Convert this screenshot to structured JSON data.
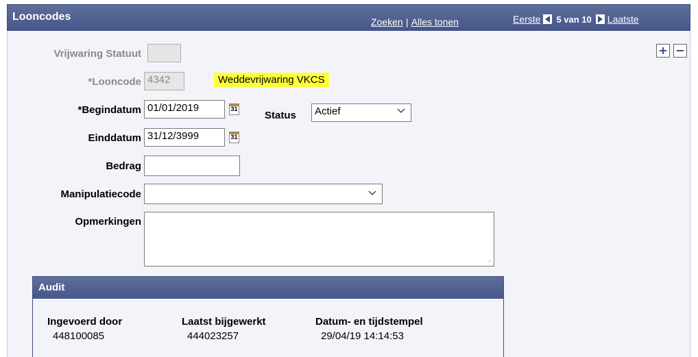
{
  "header": {
    "title": "Looncodes",
    "search_link": "Zoeken",
    "separator": "|",
    "show_all_link": "Alles tonen",
    "first_link": "Eerste",
    "count_text": "5 van 10",
    "last_link": "Laatste"
  },
  "form": {
    "vrijwaring_statuut": {
      "label": "Vrijwaring Statuut",
      "value": ""
    },
    "looncode": {
      "label": "*Looncode",
      "value": "4342",
      "description": "Weddevrijwaring VKCS"
    },
    "begindatum": {
      "label": "*Begindatum",
      "value": "01/01/2019"
    },
    "status": {
      "label": "Status",
      "value": "Actief"
    },
    "einddatum": {
      "label": "Einddatum",
      "value": "31/12/3999"
    },
    "bedrag": {
      "label": "Bedrag",
      "value": ""
    },
    "manipulatiecode": {
      "label": "Manipulatiecode",
      "value": ""
    },
    "opmerkingen": {
      "label": "Opmerkingen",
      "value": ""
    },
    "calendar_glyph": "31"
  },
  "row_buttons": {
    "add": "+",
    "remove": "−"
  },
  "audit": {
    "title": "Audit",
    "ingevoerd_door": {
      "label": "Ingevoerd door",
      "value": "448100085"
    },
    "laatst_bijgewerkt": {
      "label": "Laatst bijgewerkt",
      "value": "444023257"
    },
    "tijdstempel": {
      "label": "Datum- en tijdstempel",
      "value": "29/04/19 14:14:53"
    }
  },
  "colors": {
    "header": "#4f5f8f",
    "panel": "#f2f4fa",
    "highlight": "#ffff3c"
  },
  "icons": [
    "nav-first-icon",
    "nav-next-icon",
    "calendar-icon",
    "plus-icon",
    "minus-icon",
    "chevron-down-icon"
  ]
}
